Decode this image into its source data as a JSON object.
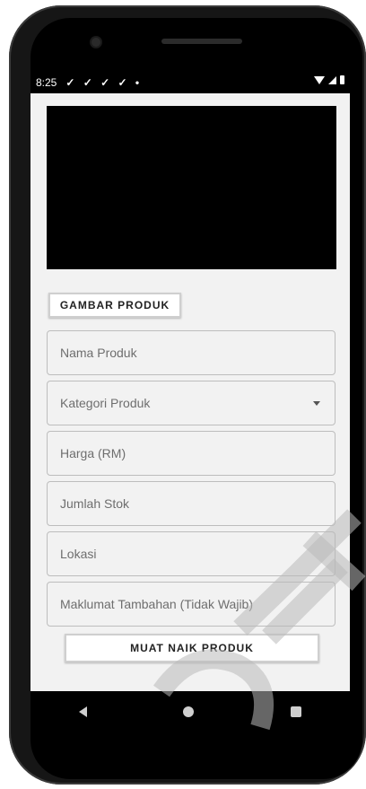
{
  "status": {
    "time": "8:25",
    "notification_icons": "✓ ✓ ✓ ✓ •"
  },
  "form": {
    "image_button_label": "GAMBAR PRODUK",
    "fields": [
      {
        "placeholder": "Nama Produk"
      },
      {
        "placeholder": "Kategori Produk"
      },
      {
        "placeholder": "Harga (RM)"
      },
      {
        "placeholder": "Jumlah Stok"
      },
      {
        "placeholder": "Lokasi"
      },
      {
        "placeholder": "Maklumat Tambahan (Tidak Wajib)"
      }
    ],
    "upload_button_label": "MUAT NAIK PRODUK"
  }
}
